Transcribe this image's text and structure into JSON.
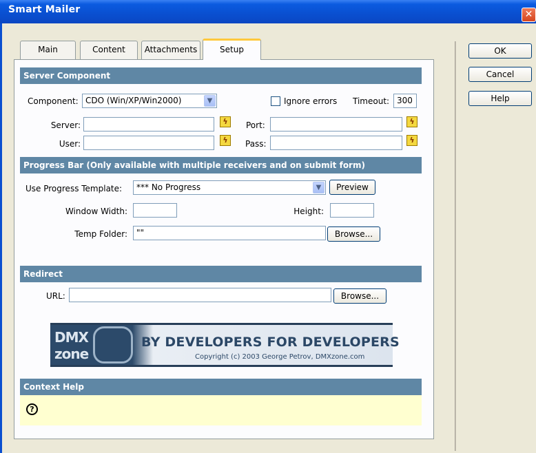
{
  "window": {
    "title": "Smart Mailer",
    "close_glyph": "✕"
  },
  "tabs": [
    {
      "label": "Main"
    },
    {
      "label": "Content"
    },
    {
      "label": "Attachments"
    },
    {
      "label": "Setup"
    }
  ],
  "dialog_buttons": {
    "ok": "OK",
    "cancel": "Cancel",
    "help": "Help"
  },
  "server_component": {
    "header": "Server Component",
    "component_label": "Component:",
    "component_value": "CDO (Win/XP/Win2000)",
    "ignore_errors_label": "Ignore errors",
    "ignore_errors_checked": false,
    "timeout_label": "Timeout:",
    "timeout_value": "300",
    "server_label": "Server:",
    "server_value": "",
    "port_label": "Port:",
    "port_value": "",
    "user_label": "User:",
    "user_value": "",
    "pass_label": "Pass:",
    "pass_value": ""
  },
  "progress_bar": {
    "header": "Progress Bar (Only available with multiple receivers and on submit form)",
    "template_label": "Use Progress Template:",
    "template_value": "*** No Progress",
    "preview_button": "Preview",
    "window_width_label": "Window Width:",
    "window_width_value": "",
    "height_label": "Height:",
    "height_value": "",
    "temp_folder_label": "Temp Folder:",
    "temp_folder_value": "\"\"",
    "browse_button": "Browse..."
  },
  "redirect": {
    "header": "Redirect",
    "url_label": "URL:",
    "url_value": "",
    "browse_button": "Browse..."
  },
  "banner": {
    "logo_top": "DMX",
    "logo_bottom": "zone",
    "slogan": "BY DEVELOPERS FOR DEVELOPERS",
    "copyright": "Copyright (c) 2003 George Petrov, DMXzone.com"
  },
  "context_help": {
    "header": "Context Help",
    "icon_glyph": "?"
  },
  "icons": {
    "lightning": "lightning-icon",
    "dropdown": "chevron-down-icon",
    "help": "help-icon"
  }
}
